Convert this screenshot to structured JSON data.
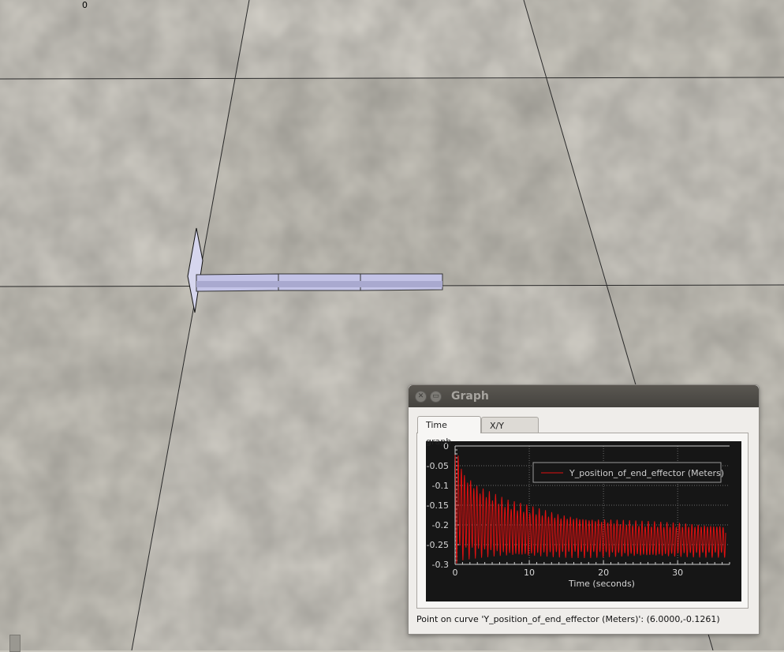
{
  "scene": {
    "frame_counter": "0",
    "floor_colors": [
      "#cfccc4",
      "#c8c5bc",
      "#d2cfc7",
      "#c4c1b8"
    ],
    "link_color": "#c3c3e6"
  },
  "graph_window": {
    "title": "Graph",
    "tabs": [
      {
        "label": "Time graph",
        "active": true
      },
      {
        "label": "X/Y graph",
        "active": false
      }
    ],
    "status": "Point on curve 'Y_position_of_end_effector (Meters)': (6.0000,-0.1261)"
  },
  "chart_data": {
    "type": "line",
    "xlabel": "Time (seconds)",
    "ylabel": "",
    "xlim": [
      0,
      37
    ],
    "ylim": [
      -0.3,
      0
    ],
    "x_ticks": [
      0,
      10,
      20,
      30
    ],
    "y_ticks": [
      0,
      -0.05,
      -0.1,
      -0.15,
      -0.2,
      -0.25,
      -0.3
    ],
    "x_tick_labels": [
      "0",
      "10",
      "20",
      "30"
    ],
    "y_tick_labels": [
      "0",
      "-0.05",
      "-0.1",
      "-0.15",
      "-0.2",
      "-0.25",
      "-0.3"
    ],
    "grid": true,
    "legend": "top-right",
    "background": "#161616",
    "series": [
      {
        "name": "Y_position_of_end_effector (Meters)",
        "color": "#e01010",
        "description_values": {
          "x": [
            0,
            0.5,
            1,
            1.5,
            2,
            2.5,
            3,
            3.5,
            4,
            5,
            6,
            7,
            8,
            9,
            10,
            12,
            14,
            16,
            18,
            20,
            22,
            24,
            26,
            28,
            30,
            32,
            34,
            36
          ],
          "y_upper": [
            0,
            -0.005,
            -0.05,
            -0.07,
            -0.075,
            -0.085,
            -0.095,
            -0.1,
            -0.105,
            -0.115,
            -0.125,
            -0.135,
            -0.14,
            -0.145,
            -0.15,
            -0.16,
            -0.17,
            -0.175,
            -0.18,
            -0.182,
            -0.185,
            -0.188,
            -0.19,
            -0.192,
            -0.193,
            -0.195,
            -0.197,
            -0.198
          ],
          "y_lower": [
            -0.3,
            -0.295,
            -0.29,
            -0.29,
            -0.288,
            -0.287,
            -0.287,
            -0.286,
            -0.286,
            -0.285,
            -0.285,
            -0.285,
            -0.285,
            -0.285,
            -0.285,
            -0.284,
            -0.284,
            -0.284,
            -0.284,
            -0.283,
            -0.283,
            -0.283,
            -0.283,
            -0.283,
            -0.283,
            -0.283,
            -0.283,
            -0.283
          ]
        }
      }
    ]
  }
}
